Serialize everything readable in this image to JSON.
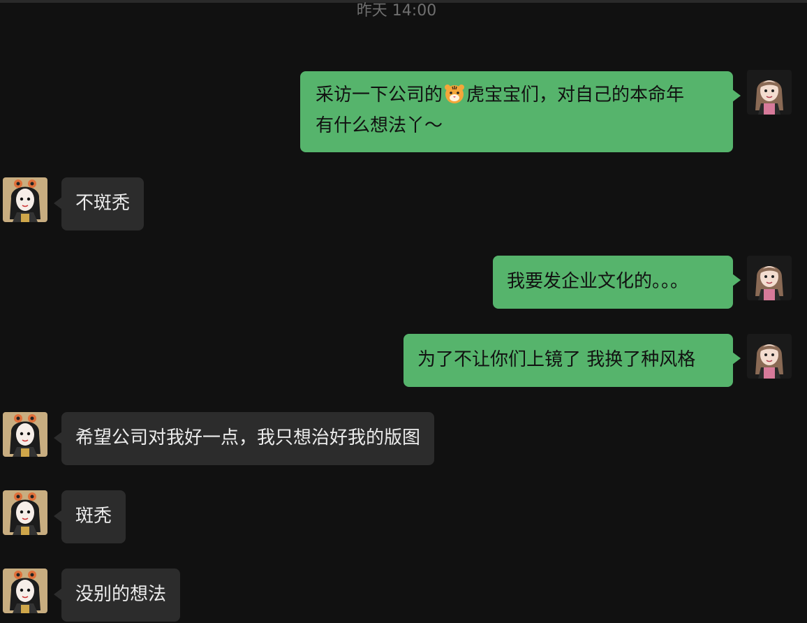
{
  "chat": {
    "timestamp": "昨天 14:00",
    "messages": [
      {
        "side": "sent",
        "lines": [
          "采访一下公司的",
          "虎宝宝们，对自己的本命年",
          "有什么想法丫～"
        ],
        "emoji": "tiger-face-icon"
      },
      {
        "side": "received",
        "text": "不斑秃"
      },
      {
        "side": "sent",
        "text": "我要发企业文化的。。。"
      },
      {
        "side": "sent",
        "text": "为了不让你们上镜了 我换了种风格"
      },
      {
        "side": "received",
        "text": "希望公司对我好一点，我只想治好我的版图"
      },
      {
        "side": "received",
        "text": "斑秃"
      },
      {
        "side": "received",
        "text": "没别的想法"
      }
    ]
  },
  "colors": {
    "background": "#111111",
    "sent_bubble": "#56b46c",
    "received_bubble": "#2c2c2c",
    "timestamp": "#6f6f6f"
  }
}
